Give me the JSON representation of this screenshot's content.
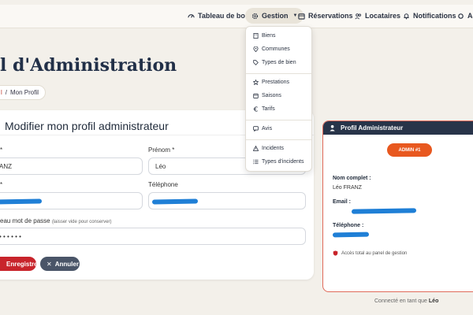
{
  "nav": {
    "dashboard": "Tableau de bord",
    "gestion": "Gestion",
    "reservations": "Réservations",
    "locataires": "Locataires",
    "notifications": "Notifications",
    "admin": "Ad"
  },
  "dropdown": {
    "items": [
      "Biens",
      "Communes",
      "Types de bien",
      "Prestations",
      "Saisons",
      "Tarifs",
      "Avis",
      "Incidents",
      "Types d'incidents"
    ]
  },
  "page": {
    "title": "nel d'Administration",
    "breadcrumb_first": "l",
    "breadcrumb_sep": "/",
    "breadcrumb_current": "Mon Profil"
  },
  "form": {
    "title": "Modifier mon profil administrateur",
    "nom_label": "*",
    "nom_value": "ANZ",
    "prenom_label": "Prénom *",
    "prenom_value": "Léo",
    "email_label": "*",
    "telephone_label": "Téléphone",
    "password_label": "eau mot de passe",
    "password_hint": "(laisser vide pour conserver)",
    "password_value": "• • • • • •",
    "save_label": "Enregistrer",
    "cancel_label": "Annuler"
  },
  "profile": {
    "header": "Profil Administrateur",
    "badge": "ADMIN #1",
    "fullname_label": "Nom complet :",
    "fullname_value": "Léo FRANZ",
    "email_label": "Email :",
    "phone_label": "Téléphone :",
    "access_text": "Accès total au panel de gestion"
  },
  "footer": {
    "prefix": "Connecté en tant que",
    "user": "Léo"
  },
  "colors": {
    "primary": "#c8242b",
    "navy": "#283449",
    "badge": "#e8581f",
    "redact": "#1f7fd6"
  }
}
